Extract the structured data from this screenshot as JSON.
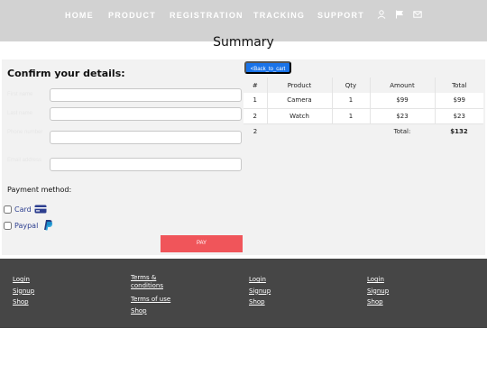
{
  "nav": {
    "items": [
      "HOME",
      "PRODUCT",
      "REGISTRATION",
      "TRACKING",
      "SUPPORT"
    ],
    "icons": [
      "user-icon",
      "flag-icon",
      "mail-icon"
    ]
  },
  "page": {
    "title": "Summary"
  },
  "form": {
    "heading": "Confirm your details:",
    "fields": [
      {
        "label": "First name",
        "value": ""
      },
      {
        "label": "Last name",
        "value": ""
      },
      {
        "label": "Phone number",
        "value": ""
      },
      {
        "label": "Email address",
        "value": ""
      }
    ]
  },
  "payment": {
    "title": "Payment method:",
    "options": [
      {
        "label": "Card",
        "icon": "credit-card-icon",
        "checked": false
      },
      {
        "label": "Paypal",
        "icon": "paypal-icon",
        "checked": false
      }
    ],
    "pay_label": "PAY"
  },
  "cart": {
    "back_label": "<Back_to_cart",
    "headers": [
      "#",
      "Product",
      "Qty",
      "Amount",
      "Total"
    ],
    "rows": [
      [
        "1",
        "Camera",
        "1",
        "$99",
        "$99"
      ],
      [
        "2",
        "Watch",
        "1",
        "$23",
        "$23"
      ]
    ],
    "summary": {
      "count": "2",
      "label": "Total:",
      "value": "$132"
    }
  },
  "footer": {
    "columns": [
      [
        "Login",
        "Signup",
        "Shop"
      ],
      [
        "Terms & conditions",
        "Terms of use",
        "Shop"
      ],
      [
        "Login",
        "Signup",
        "Shop"
      ],
      [
        "Login",
        "Signup",
        "Shop"
      ]
    ]
  },
  "colors": {
    "nav_bg": "#d2d2d2",
    "accent_blue": "#1a73e8",
    "pay_button": "#f0555a",
    "footer_bg": "#464646"
  }
}
